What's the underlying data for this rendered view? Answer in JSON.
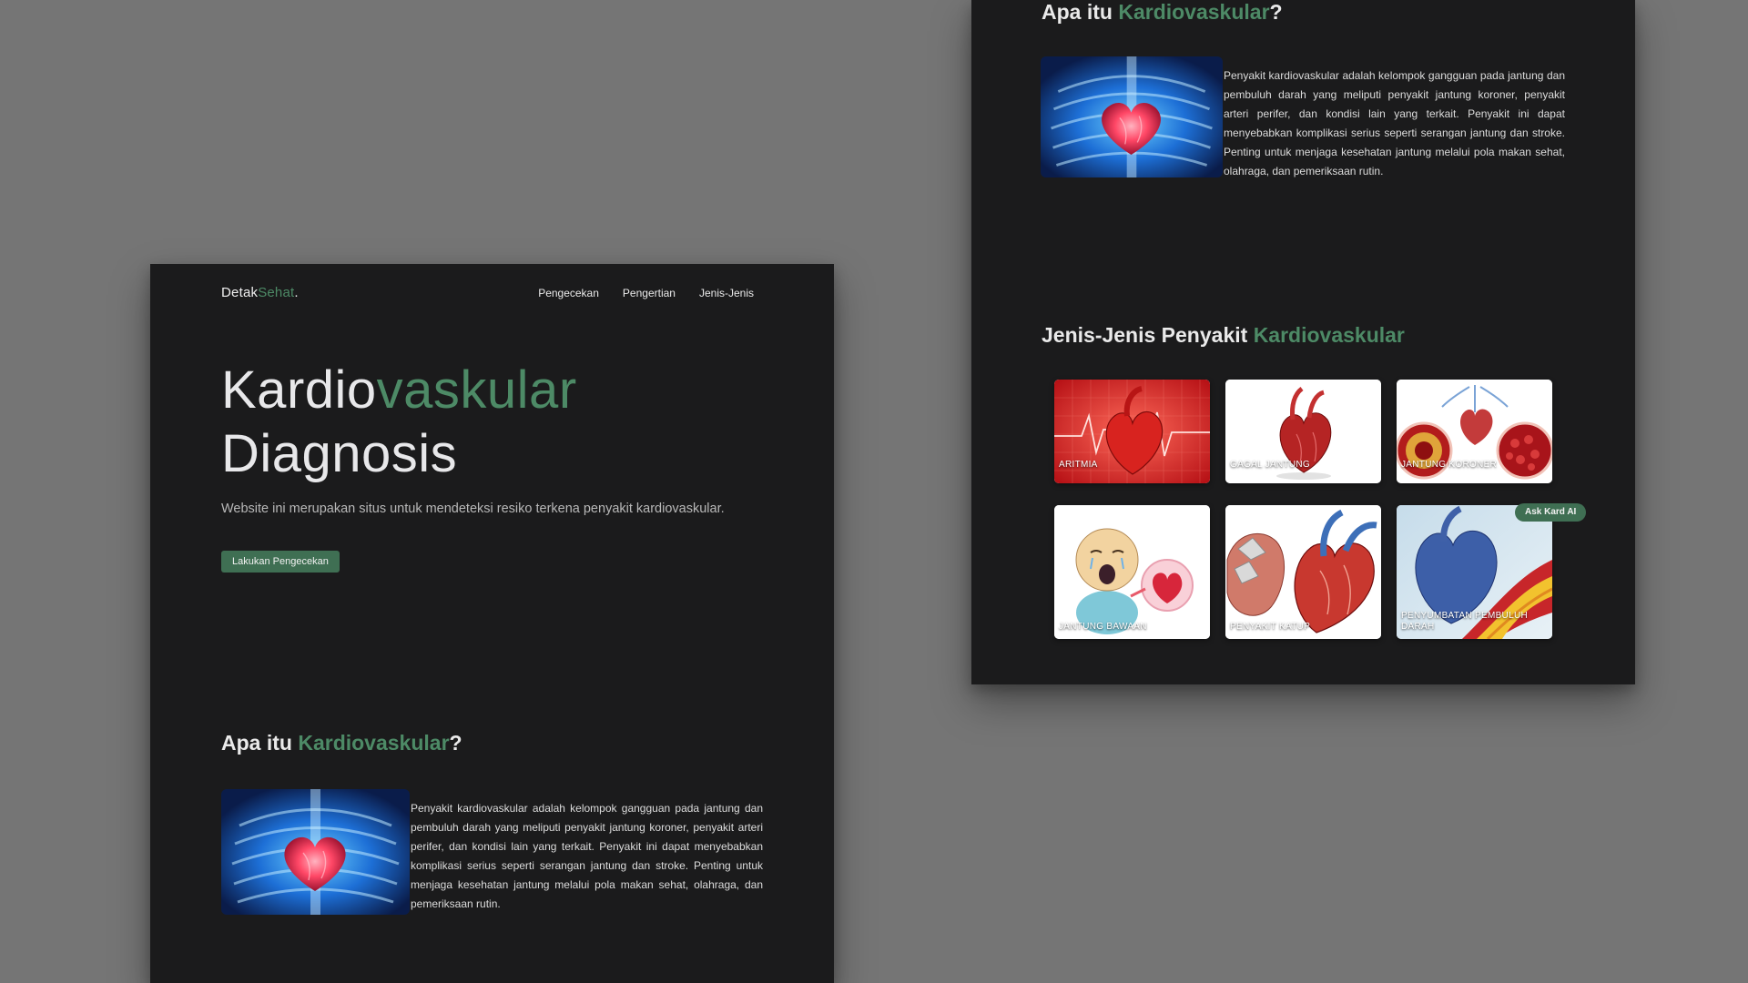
{
  "brand": {
    "name_part1": "Detak",
    "name_part2": "Sehat",
    "dot": "."
  },
  "nav": {
    "items": [
      "Pengecekan",
      "Pengertian",
      "Jenis-Jenis"
    ]
  },
  "hero": {
    "title_part1": "Kardio",
    "title_part2": "vaskular",
    "title_line2": "Diagnosis",
    "subtitle": "Website ini merupakan situs untuk mendeteksi resiko terkena penyakit kardiovaskular.",
    "cta_label": "Lakukan Pengecekan"
  },
  "about": {
    "title_prefix": "Apa itu ",
    "title_accent": "Kardiovaskular",
    "title_suffix": "?",
    "image_icon": "heart-chest-xray-image",
    "text": "Penyakit kardiovaskular adalah kelompok gangguan pada jantung dan pembuluh darah yang meliputi penyakit jantung koroner, penyakit arteri perifer, dan kondisi lain yang terkait. Penyakit ini dapat menyebabkan komplikasi serius seperti serangan jantung dan stroke. Penting untuk menjaga kesehatan jantung melalui pola makan sehat, olahraga, dan pemeriksaan rutin."
  },
  "types": {
    "title_prefix": "Jenis-Jenis Penyakit ",
    "title_accent": "Kardiovaskular",
    "cards": [
      {
        "label": "ARITMIA",
        "icon": "heart-ecg-image"
      },
      {
        "label": "GAGAL JANTUNG",
        "icon": "heart-anatomy-image"
      },
      {
        "label": "JANTUNG KORONER",
        "icon": "coronary-artery-image"
      },
      {
        "label": "JANTUNG BAWAAN",
        "icon": "baby-heart-image"
      },
      {
        "label": "PENYAKIT KATUP",
        "icon": "heart-valve-image"
      },
      {
        "label": "PENYUMBATAN PEMBULUH DARAH",
        "icon": "blocked-artery-image"
      }
    ]
  },
  "ask_ai": {
    "label": "Ask Kard AI"
  },
  "colors": {
    "accent": "#4d8a66",
    "button": "#3f6f53",
    "panel": "#1b1b1c",
    "backdrop": "#757575"
  }
}
